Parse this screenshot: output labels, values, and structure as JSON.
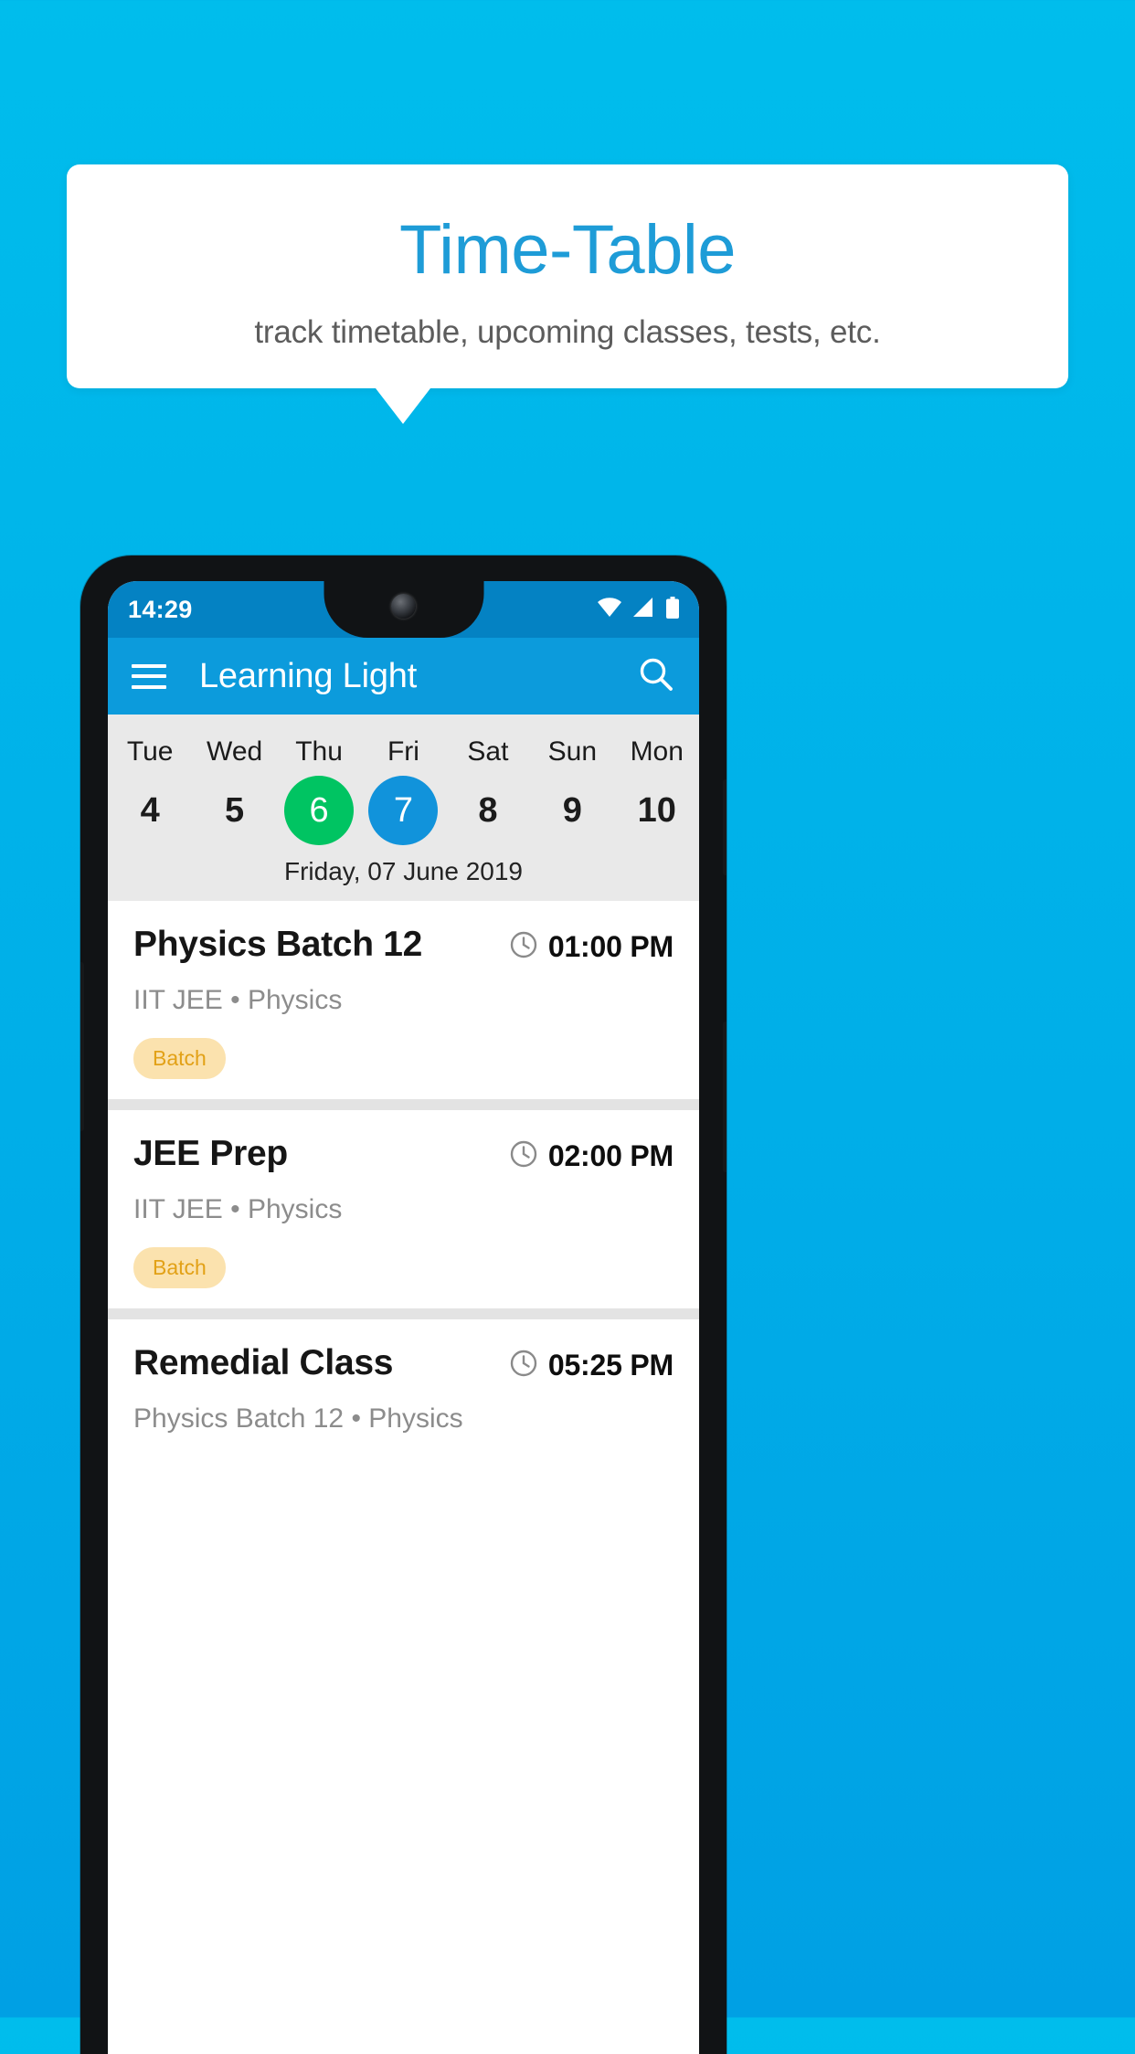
{
  "promo": {
    "title": "Time-Table",
    "subtitle": "track timetable, upcoming classes, tests, etc.",
    "title_color": "#1E9CD7",
    "background_color": "#00B0E8"
  },
  "phone": {
    "status_bar": {
      "time": "14:29",
      "icons": [
        "wifi-icon",
        "signal-icon",
        "battery-icon"
      ],
      "background_color": "#0482C3"
    },
    "app_bar": {
      "menu_icon": "hamburger-icon",
      "title": "Learning Light",
      "search_icon": "search-icon",
      "background_color": "#0C9BDC"
    },
    "date_strip": {
      "background_color": "#E9E9E9",
      "days": [
        {
          "day": "Tue",
          "num": "4",
          "state": "normal"
        },
        {
          "day": "Wed",
          "num": "5",
          "state": "normal"
        },
        {
          "day": "Thu",
          "num": "6",
          "state": "today"
        },
        {
          "day": "Fri",
          "num": "7",
          "state": "selected"
        },
        {
          "day": "Sat",
          "num": "8",
          "state": "normal"
        },
        {
          "day": "Sun",
          "num": "9",
          "state": "normal"
        },
        {
          "day": "Mon",
          "num": "10",
          "state": "normal"
        }
      ],
      "today_color": "#00C462",
      "selected_color": "#1193DB",
      "selected_date_label": "Friday, 07 June 2019"
    },
    "classes": [
      {
        "title": "Physics Batch 12",
        "time": "01:00 PM",
        "subtitle": "IIT JEE • Physics",
        "badge": "Batch"
      },
      {
        "title": "JEE Prep",
        "time": "02:00 PM",
        "subtitle": "IIT JEE • Physics",
        "badge": "Batch"
      },
      {
        "title": "Remedial Class",
        "time": "05:25 PM",
        "subtitle": "Physics Batch 12 • Physics",
        "badge": ""
      }
    ],
    "badge_bg_color": "#FBE2AE",
    "badge_text_color": "#E2A117"
  }
}
